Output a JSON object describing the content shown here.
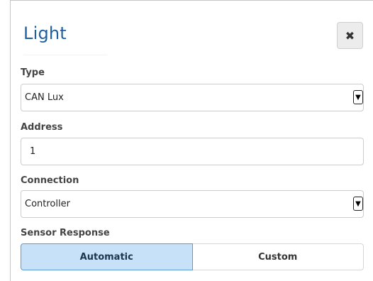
{
  "dialog": {
    "title": "Light",
    "close_icon": "close-icon"
  },
  "type": {
    "label": "Type",
    "value": "CAN Lux"
  },
  "address": {
    "label": "Address",
    "value": "1"
  },
  "connection": {
    "label": "Connection",
    "value": "Controller"
  },
  "sensor_response": {
    "label": "Sensor Response",
    "options": [
      "Automatic",
      "Custom"
    ],
    "selected": "Automatic"
  },
  "colors": {
    "title": "#1f5f9e",
    "active_segment": "#c7e1f8",
    "active_segment_border": "#5b9bd5"
  }
}
